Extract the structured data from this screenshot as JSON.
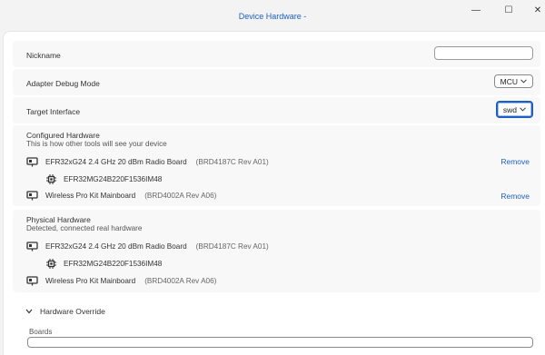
{
  "window": {
    "title": "Device Hardware -",
    "minimize_glyph": "—",
    "maximize_glyph": "☐",
    "close_glyph": "✕"
  },
  "settings": {
    "nickname_label": "Nickname",
    "nickname_value": "",
    "adapter_debug_mode_label": "Adapter Debug Mode",
    "adapter_debug_mode_value": "MCU",
    "target_interface_label": "Target Interface",
    "target_interface_value": "swd"
  },
  "configured": {
    "title": "Configured Hardware",
    "subtitle": "This is how other tools will see your device",
    "items": [
      {
        "name": "EFR32xG24 2.4 GHz 20 dBm Radio Board",
        "rev": "(BRD4187C Rev A01)",
        "icon": "board-icon",
        "action": "Remove"
      },
      {
        "name": "EFR32MG24B220F1536IM48",
        "rev": "",
        "icon": "chip-icon",
        "action": ""
      },
      {
        "name": "Wireless Pro Kit Mainboard",
        "rev": "(BRD4002A Rev A06)",
        "icon": "board-icon",
        "action": "Remove"
      }
    ]
  },
  "physical": {
    "title": "Physical Hardware",
    "subtitle": "Detected, connected real hardware",
    "items": [
      {
        "name": "EFR32xG24 2.4 GHz 20 dBm Radio Board",
        "rev": "(BRD4187C Rev A01)",
        "icon": "board-icon"
      },
      {
        "name": "EFR32MG24B220F1536IM48",
        "rev": "",
        "icon": "chip-icon"
      },
      {
        "name": "Wireless Pro Kit Mainboard",
        "rev": "(BRD4002A Rev A06)",
        "icon": "board-icon"
      }
    ]
  },
  "override": {
    "title": "Hardware Override",
    "boards_label": "Boards",
    "boards_value": ""
  },
  "colors": {
    "accent": "#1f5fbf",
    "background": "#f3f3f3",
    "card": "#f8f8f8"
  }
}
